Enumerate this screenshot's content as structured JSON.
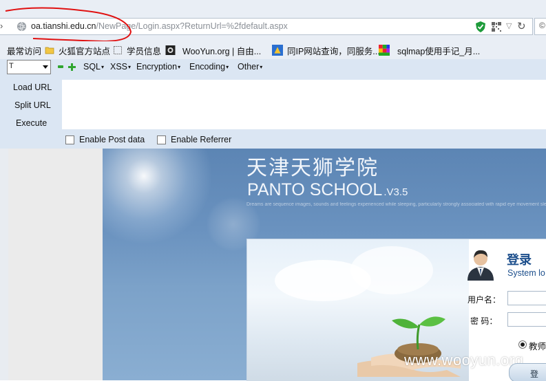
{
  "browser": {
    "url_host": "oa.tianshi.edu.cn",
    "url_path": "/NewPage/Login.aspx?ReturnUrl=%2fdefault.aspx",
    "icons": {
      "back": "back-arrow-icon",
      "site": "globe-icon",
      "security": "shield-check-icon",
      "qr": "qr-code-icon",
      "dropdown": "url-dropdown-icon",
      "reload": "reload-icon"
    }
  },
  "bookmarks": [
    {
      "label": "最常访问",
      "icon": "none"
    },
    {
      "label": "火狐官方站点",
      "icon": "folder-icon"
    },
    {
      "label": "学员信息",
      "icon": "page-icon"
    },
    {
      "label": "WooYun.org | 自由...",
      "icon": "wooyun-icon"
    },
    {
      "label": "同IP网站查询，同服务...",
      "icon": "page-icon"
    },
    {
      "label": "sqlmap使用手记_月...",
      "icon": "sqlmap-icon"
    }
  ],
  "hackbar": {
    "select_value": "T",
    "menus": [
      "SQL",
      "XSS",
      "Encryption",
      "Encoding",
      "Other"
    ],
    "buttons": [
      "Load URL",
      "Split URL",
      "Execute"
    ],
    "checkboxes": [
      {
        "label": "Enable Post data",
        "checked": false
      },
      {
        "label": "Enable Referrer",
        "checked": false
      }
    ],
    "textarea_value": ""
  },
  "page": {
    "school_cn": "天津天狮学院",
    "school_en": "PANTO SCHOOL",
    "school_version": ".V3.5",
    "tagline": "Dreams are sequence images, sounds and feelings experienced while sleeping, particularly strongly associated with rapid eye movement sleep.The contents and biological purposes of dreams are not fully understood, though they have been a topic of speculation and interest throughout recorded history. The scientific study of dreams is known as oneirology.",
    "login": {
      "title": "登录",
      "subtitle": "System lo",
      "username_label": "用户名：",
      "password_label": "密  码：",
      "username_value": "",
      "password_value": "",
      "role_label": "教师",
      "role_selected": true,
      "button_label": "登"
    },
    "watermark": "www.wooyun.org"
  },
  "colors": {
    "title_blue": "#1d4f8c",
    "hackbar_bg": "#dbe6f3",
    "annotation_red": "#e01010"
  }
}
